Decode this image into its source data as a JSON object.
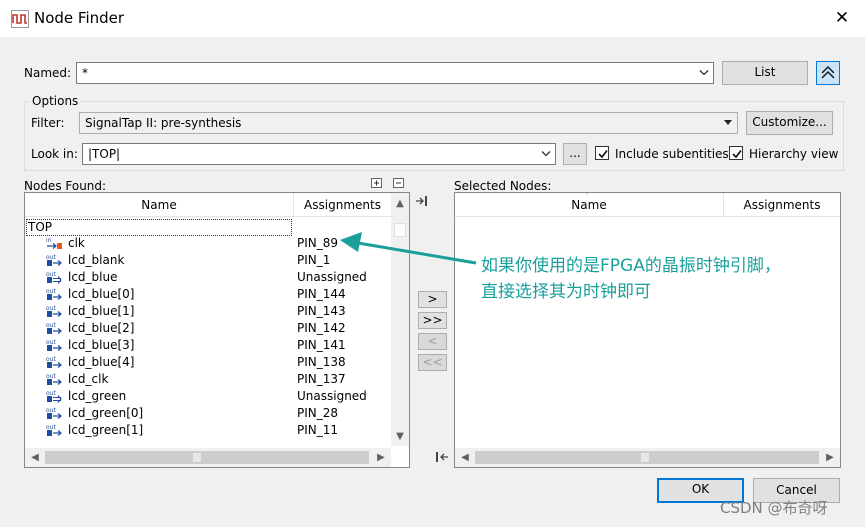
{
  "window": {
    "title": "Node Finder",
    "close_glyph": "✕"
  },
  "named": {
    "label": "Named:",
    "value": "*",
    "list_button": "List"
  },
  "options": {
    "legend": "Options",
    "filter_label": "Filter:",
    "filter_value": "SignalTap II: pre-synthesis",
    "customize_button": "Customize...",
    "lookin_label": "Look in:",
    "lookin_value": "|TOP|",
    "browse_button": "...",
    "include_subentities": {
      "label": "Include subentities",
      "checked": true
    },
    "hierarchy_view": {
      "label": "Hierarchy view",
      "checked": true
    }
  },
  "nodes_found": {
    "label": "Nodes Found:",
    "columns": [
      "Name",
      "Assignments"
    ],
    "root": "TOP",
    "rows": [
      {
        "icon": "input-pin-icon",
        "name": "clk",
        "assignment": "PIN_89"
      },
      {
        "icon": "output-pin-icon",
        "name": "lcd_blank",
        "assignment": "PIN_1"
      },
      {
        "icon": "output-bus-icon",
        "name": "lcd_blue",
        "assignment": "Unassigned"
      },
      {
        "icon": "output-pin-icon",
        "name": "lcd_blue[0]",
        "assignment": "PIN_144"
      },
      {
        "icon": "output-pin-icon",
        "name": "lcd_blue[1]",
        "assignment": "PIN_143"
      },
      {
        "icon": "output-pin-icon",
        "name": "lcd_blue[2]",
        "assignment": "PIN_142"
      },
      {
        "icon": "output-pin-icon",
        "name": "lcd_blue[3]",
        "assignment": "PIN_141"
      },
      {
        "icon": "output-pin-icon",
        "name": "lcd_blue[4]",
        "assignment": "PIN_138"
      },
      {
        "icon": "output-pin-icon",
        "name": "lcd_clk",
        "assignment": "PIN_137"
      },
      {
        "icon": "output-bus-icon",
        "name": "lcd_green",
        "assignment": "Unassigned"
      },
      {
        "icon": "output-pin-icon",
        "name": "lcd_green[0]",
        "assignment": "PIN_28"
      },
      {
        "icon": "output-pin-icon",
        "name": "lcd_green[1]",
        "assignment": "PIN_11"
      }
    ]
  },
  "transfer_buttons": [
    ">",
    ">>",
    "<",
    "<<"
  ],
  "selected_nodes": {
    "label": "Selected Nodes:",
    "columns": [
      "Name",
      "Assignments"
    ]
  },
  "footer": {
    "ok_button": "OK",
    "cancel_button": "Cancel"
  },
  "annotation": {
    "line1": "如果你使用的是FPGA的晶振时钟引脚，",
    "line2": "直接选择其为时钟即可",
    "color": "#1a9f9a"
  },
  "watermark": "CSDN @布奇呀"
}
